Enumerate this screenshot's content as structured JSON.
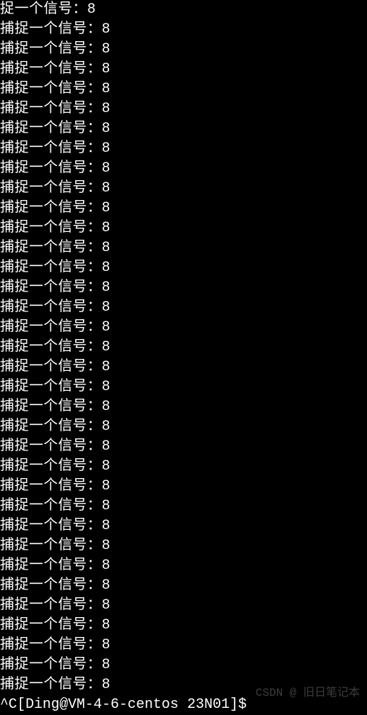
{
  "terminal": {
    "partial_first_line": {
      "text": "捉一个信号：",
      "value": "8"
    },
    "signal_line": {
      "text": "捕捉一个信号：",
      "value": "8"
    },
    "repeat_count": 34,
    "prompt": {
      "interrupt": "^C",
      "user_host": "[Ding@VM-4-6-centos",
      "path": "23N01]",
      "symbol": "$"
    }
  },
  "watermark": "CSDN @ 旧日笔记本"
}
